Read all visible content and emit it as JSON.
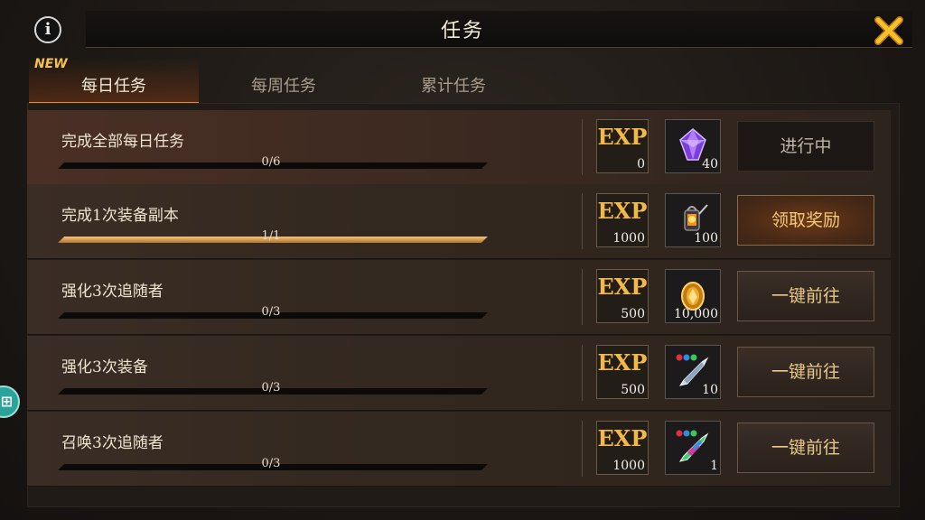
{
  "header": {
    "title": "任务",
    "info_label": "i"
  },
  "tabs": [
    {
      "label": "每日任务",
      "active": true,
      "badge": "NEW"
    },
    {
      "label": "每周任务",
      "active": false
    },
    {
      "label": "累计任务",
      "active": false
    }
  ],
  "tasks": [
    {
      "name": "完成全部每日任务",
      "progress_text": "0/6",
      "progress": 0,
      "exp_label": "EXP",
      "exp": "0",
      "reward_icon": "purple-gem-icon",
      "reward_count": "40",
      "action": "进行中",
      "state": "in-progress"
    },
    {
      "name": "完成1次装备副本",
      "progress_text": "1/1",
      "progress": 1,
      "exp_label": "EXP",
      "exp": "1000",
      "reward_icon": "lantern-icon",
      "reward_count": "100",
      "action": "领取奖励",
      "state": "claim"
    },
    {
      "name": "强化3次追随者",
      "progress_text": "0/3",
      "progress": 0,
      "exp_label": "EXP",
      "exp": "500",
      "reward_icon": "gold-coin-icon",
      "reward_count": "10,000",
      "action": "一键前往",
      "state": "go"
    },
    {
      "name": "强化3次装备",
      "progress_text": "0/3",
      "progress": 0,
      "exp_label": "EXP",
      "exp": "500",
      "reward_icon": "silver-crystal-icon",
      "reward_count": "10",
      "action": "一键前往",
      "state": "go"
    },
    {
      "name": "召唤3次追随者",
      "progress_text": "0/3",
      "progress": 0,
      "exp_label": "EXP",
      "exp": "1000",
      "reward_icon": "rainbow-crystal-icon",
      "reward_count": "1",
      "action": "一键前往",
      "state": "go"
    }
  ],
  "colors": {
    "accent": "#e88a2a",
    "exp_gold": "#f2b84a",
    "button_text": "#e8c88a"
  }
}
